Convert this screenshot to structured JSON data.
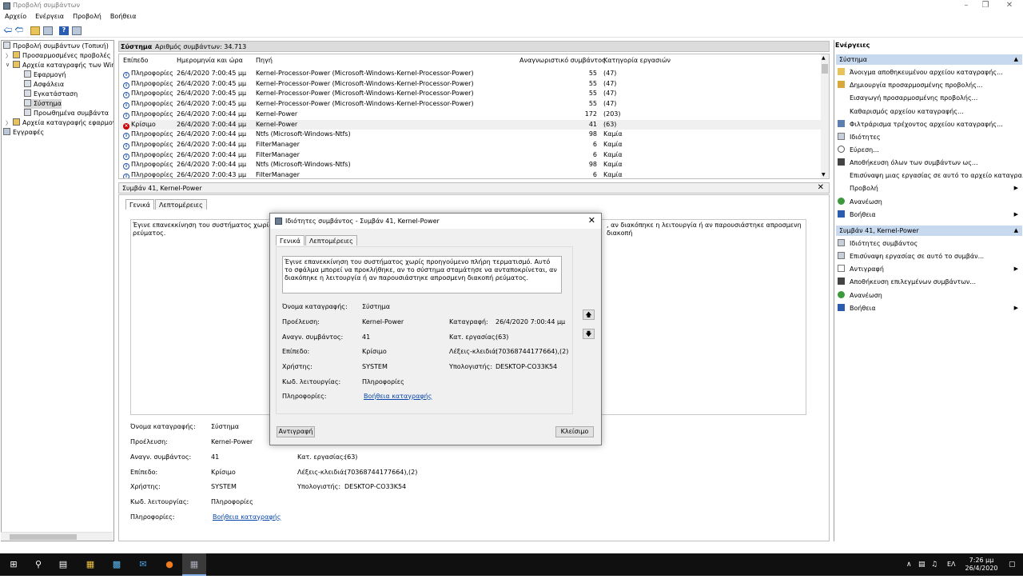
{
  "window": {
    "title": "Προβολή συμβάντων"
  },
  "menu": [
    "Αρχείο",
    "Ενέργεια",
    "Προβολή",
    "Βοήθεια"
  ],
  "tree": {
    "root": "Προβολή συμβάντων (Τοπική)",
    "custom_views": "Προσαρμοσμένες προβολές",
    "windows_logs": "Αρχεία καταγραφής των Windo",
    "application": "Εφαρμογή",
    "security": "Ασφάλεια",
    "setup": "Εγκατάσταση",
    "system": "Σύστημα",
    "forwarded": "Προωθημένα συμβάντα",
    "app_logs": "Αρχεία καταγραφής εφαρμογώ",
    "subscriptions": "Εγγραφές"
  },
  "list": {
    "log_name": "Σύστημα",
    "count": "Αριθμός συμβάντων: 34.713",
    "columns": [
      "Επίπεδο",
      "Ημερομηνία και ώρα",
      "Πηγή",
      "Αναγνωριστικό συμβάντος",
      "Κατηγορία εργασιών"
    ],
    "rows": [
      {
        "level": "Πληροφορίες",
        "date": "26/4/2020 7:00:45 μμ",
        "source": "Kernel-Processor-Power (Microsoft-Windows-Kernel-Processor-Power)",
        "id": "55",
        "task": "(47)"
      },
      {
        "level": "Πληροφορίες",
        "date": "26/4/2020 7:00:45 μμ",
        "source": "Kernel-Processor-Power (Microsoft-Windows-Kernel-Processor-Power)",
        "id": "55",
        "task": "(47)"
      },
      {
        "level": "Πληροφορίες",
        "date": "26/4/2020 7:00:45 μμ",
        "source": "Kernel-Processor-Power (Microsoft-Windows-Kernel-Processor-Power)",
        "id": "55",
        "task": "(47)"
      },
      {
        "level": "Πληροφορίες",
        "date": "26/4/2020 7:00:45 μμ",
        "source": "Kernel-Processor-Power (Microsoft-Windows-Kernel-Processor-Power)",
        "id": "55",
        "task": "(47)"
      },
      {
        "level": "Πληροφορίες",
        "date": "26/4/2020 7:00:44 μμ",
        "source": "Kernel-Power",
        "id": "172",
        "task": "(203)"
      },
      {
        "level": "Κρίσιμο",
        "date": "26/4/2020 7:00:44 μμ",
        "source": "Kernel-Power",
        "id": "41",
        "task": "(63)"
      },
      {
        "level": "Πληροφορίες",
        "date": "26/4/2020 7:00:44 μμ",
        "source": "Ntfs (Microsoft-Windows-Ntfs)",
        "id": "98",
        "task": "Καμία"
      },
      {
        "level": "Πληροφορίες",
        "date": "26/4/2020 7:00:44 μμ",
        "source": "FilterManager",
        "id": "6",
        "task": "Καμία"
      },
      {
        "level": "Πληροφορίες",
        "date": "26/4/2020 7:00:44 μμ",
        "source": "FilterManager",
        "id": "6",
        "task": "Καμία"
      },
      {
        "level": "Πληροφορίες",
        "date": "26/4/2020 7:00:44 μμ",
        "source": "Ntfs (Microsoft-Windows-Ntfs)",
        "id": "98",
        "task": "Καμία"
      },
      {
        "level": "Πληροφορίες",
        "date": "26/4/2020 7:00:43 μμ",
        "source": "FilterManager",
        "id": "6",
        "task": "Καμία"
      }
    ]
  },
  "detail": {
    "title": "Συμβάν 41, Kernel-Power",
    "tab_general": "Γενικά",
    "tab_details": "Λεπτομέρειες",
    "desc_left": "Έγινε επανεκκίνηση του συστήματος χωρίς προ",
    "desc_right": ", αν διακόπηκε η λειτουργία ή αν παρουσιάστηκε απροσμενη διακοπή",
    "desc_line2": "ρεύματος.",
    "log_name_label": "Όνομα καταγραφής:",
    "log_name": "Σύστημα",
    "source_label": "Προέλευση:",
    "source": "Kernel-Power",
    "logged_label": "Καταγραφή:",
    "logged": "26/4/2020 7:00:44 μμ",
    "event_id_label": "Αναγν. συμβάντος:",
    "event_id": "41",
    "task_label": "Κατ. εργασίας:",
    "task": "(63)",
    "level_label": "Επίπεδο:",
    "level": "Κρίσιμο",
    "keywords_label": "Λέξεις-κλειδιά:",
    "keywords": "(70368744177664),(2)",
    "user_label": "Χρήστης:",
    "user": "SYSTEM",
    "computer_label": "Υπολογιστής:",
    "computer": "DESKTOP-CO33K54",
    "opcode_label": "Κωδ. λειτουργίας:",
    "opcode": "Πληροφορίες",
    "more_label": "Πληροφορίες:",
    "more_link": "Βοήθεια καταγραφής"
  },
  "dialog": {
    "title": "Ιδιότητες συμβάντος - Συμβάν 41, Kernel-Power",
    "tab_general": "Γενικά",
    "tab_details": "Λεπτομέρειες",
    "description": "Έγινε επανεκκίνηση του συστήματος χωρίς προηγούμενο πλήρη τερματισμό. Αυτό το σφάλμα μπορεί να προκλήθηκε, αν το σύστημα σταμάτησε να ανταποκρίνεται, αν διακόπηκε η λειτουργία ή αν παρουσιάστηκε απροσμενη διακοπή ρεύματος.",
    "copy_button": "Αντιγραφή",
    "close_button": "Κλείσιμο",
    "up_arrow": "🡅",
    "down_arrow": "🡇"
  },
  "actions": {
    "title": "Ενέργειες",
    "section1": "Σύστημα",
    "items1": [
      "Άνοιγμα αποθηκευμένου αρχείου καταγραφής...",
      "Δημιουργία προσαρμοσμένης προβολής...",
      "Εισαγωγή προσαρμοσμένης προβολής...",
      "Καθαρισμός αρχείου καταγραφής...",
      "Φιλτράρισμα τρέχοντος αρχείου καταγραφής...",
      "Ιδιότητες",
      "Εύρεση...",
      "Αποθήκευση όλων των συμβάντων ως...",
      "Επισύναψη μιας εργασίας σε αυτό το αρχείο καταγρα...",
      "Προβολή",
      "Ανανέωση",
      "Βοήθεια"
    ],
    "section2": "Συμβάν 41, Kernel-Power",
    "items2": [
      "Ιδιότητες συμβάντος",
      "Επισύναψη εργασίας σε αυτό το συμβάν...",
      "Αντιγραφή",
      "Αποθήκευση επιλεγμένων συμβάντων...",
      "Ανανέωση",
      "Βοήθεια"
    ]
  },
  "taskbar": {
    "lang": "ΕΛ",
    "time": "7:26 μμ",
    "date": "26/4/2020"
  }
}
